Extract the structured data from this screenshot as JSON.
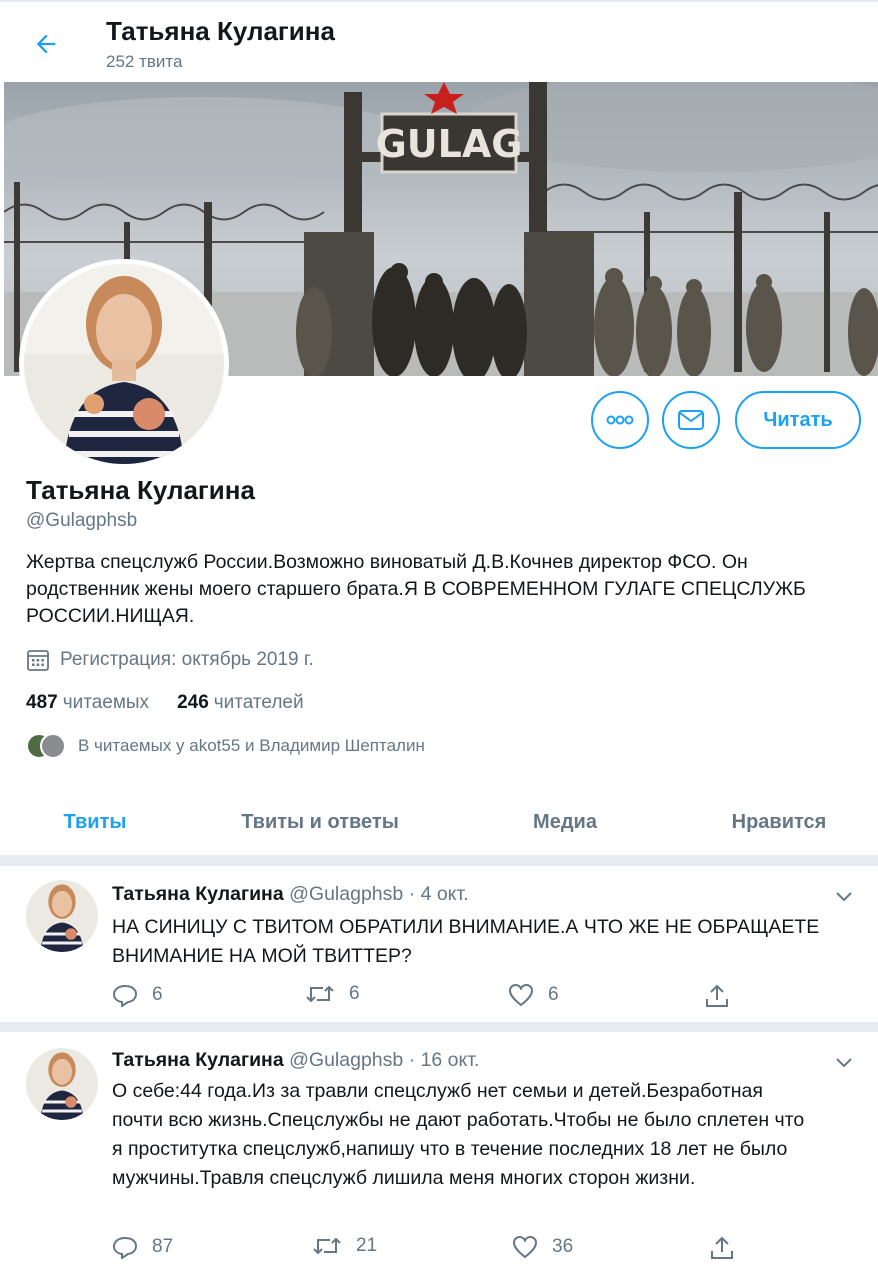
{
  "header": {
    "title": "Татьяна Кулагина",
    "tweet_count": "252 твита"
  },
  "banner": {
    "sign_text": "GULAG"
  },
  "profile": {
    "name": "Татьяна Кулагина",
    "handle": "@Gulagphsb",
    "bio": "Жертва спецслужб России.Возможно виноватый Д.В.Кочнев директор ФСО. Он родственник жены моего старшего брата.Я В СОВРЕМЕННОМ ГУЛАГЕ СПЕЦСЛУЖБ РОССИИ.НИЩАЯ.",
    "joined": "Регистрация: октябрь 2019 г.",
    "following_count": "487",
    "following_label": "читаемых",
    "followers_count": "246",
    "followers_label": "читателей",
    "followed_by": "В читаемых у akot55 и Владимир Шепталин",
    "follow_button": "Читать"
  },
  "tabs": [
    "Твиты",
    "Твиты и ответы",
    "Медиа",
    "Нравится"
  ],
  "tweets": [
    {
      "name": "Татьяна Кулагина",
      "handle": "@Gulagphsb",
      "date": "· 4 окт.",
      "text": "НА СИНИЦУ С ТВИТОМ ОБРАТИЛИ ВНИМАНИЕ.А ЧТО ЖЕ НЕ ОБРАЩАЕТЕ ВНИМАНИЕ НА МОЙ ТВИТТЕР?",
      "replies": "6",
      "retweets": "6",
      "likes": "6"
    },
    {
      "name": "Татьяна Кулагина",
      "handle": "@Gulagphsb",
      "date": "· 16 окт.",
      "text": "О себе:44 года.Из за травли спецслужб нет семьи и детей.Безработная почти всю жизнь.Спецслужбы не дают работать.Чтобы не было сплетен что я проститутка спецслужб,напишу что в течение последних 18 лет не было мужчины.Травля спецслужб лишила меня многих сторон жизни.",
      "replies": "87",
      "retweets": "21",
      "likes": "36"
    }
  ],
  "colors": {
    "accent": "#1da1f2",
    "muted": "#657786",
    "text": "#14171a",
    "divider": "#e6ecf0"
  },
  "icons": [
    "back-arrow-icon",
    "more-icon",
    "message-icon",
    "calendar-icon",
    "chevron-down-icon",
    "reply-icon",
    "retweet-icon",
    "like-icon",
    "share-icon"
  ]
}
